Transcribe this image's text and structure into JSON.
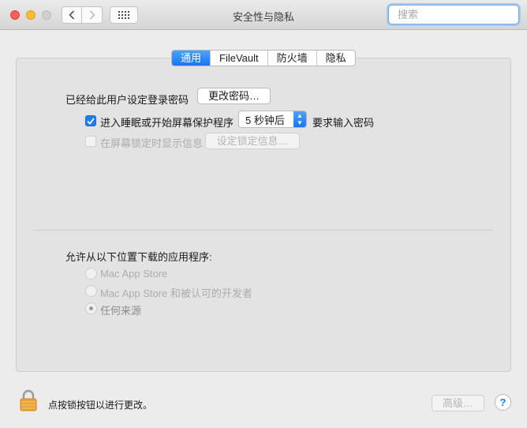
{
  "window": {
    "title": "安全性与隐私"
  },
  "toolbar": {
    "back_icon": "chevron-left-icon",
    "forward_icon": "chevron-right-icon",
    "grid_icon": "show-all-grid-icon"
  },
  "search": {
    "placeholder": "搜索",
    "value": ""
  },
  "tabs": [
    {
      "label": "通用",
      "active": true
    },
    {
      "label": "FileVault",
      "active": false
    },
    {
      "label": "防火墙",
      "active": false
    },
    {
      "label": "隐私",
      "active": false
    }
  ],
  "general": {
    "password_label": "已经给此用户设定登录密码",
    "change_password_button": "更改密码…",
    "require_password": {
      "checked": true,
      "label_before": "进入睡眠或开始屏幕保护程序",
      "delay_value": "5 秒钟后",
      "label_after": "要求输入密码"
    },
    "show_message": {
      "checked": false,
      "enabled": false,
      "label": "在屏幕锁定时显示信息",
      "button": "设定锁定信息…"
    },
    "downloads_label": "允许从以下位置下载的应用程序:",
    "download_options": [
      {
        "label": "Mac App Store",
        "selected": false
      },
      {
        "label": "Mac App Store 和被认可的开发者",
        "selected": false
      },
      {
        "label": "任何来源",
        "selected": true
      }
    ]
  },
  "footer": {
    "lock_text": "点按锁按钮以进行更改。",
    "advanced_button": "高级…",
    "help_label": "?"
  },
  "colors": {
    "accent": "#1f7cf3",
    "close": "#fc5f57",
    "minimize": "#fdbc2e",
    "lock": "#e9a53a"
  }
}
